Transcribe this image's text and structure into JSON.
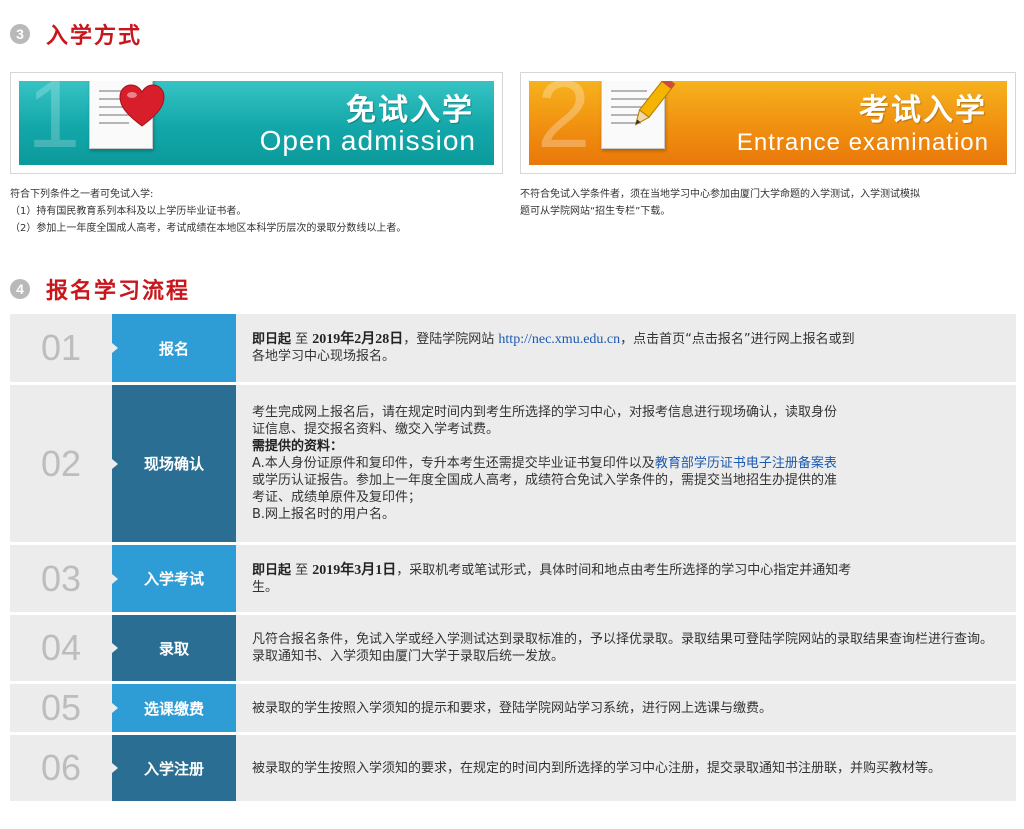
{
  "section3": {
    "number": "3",
    "title": "入学方式"
  },
  "admission": {
    "open": {
      "big_number": "1",
      "title_cn": "免试入学",
      "title_en": "Open admission",
      "lines": [
        "符合下列条件之一者可免试入学:",
        "（1）持有国民教育系列本科及以上学历毕业证书者。",
        "（2）参加上一年度全国成人高考，考试成绩在本地区本科学历层次的录取分数线以上者。"
      ]
    },
    "exam": {
      "big_number": "2",
      "title_cn": "考试入学",
      "title_en": "Entrance examination",
      "lines": [
        "不符合免试入学条件者，须在当地学习中心参加由厦门大学命题的入学测试，入学测试模拟",
        "题可从学院网站“招生专栏”下载。"
      ]
    }
  },
  "section4": {
    "number": "4",
    "title": "报名学习流程"
  },
  "steps": [
    {
      "num": "01",
      "label": "报名",
      "style": "light",
      "parts": {
        "a": "即日起",
        "b": " 至 ",
        "c": "2019年2月28日",
        "d": "，登陆学院网站 ",
        "link": "http://nec.xmu.edu.cn",
        "e": "，点击首页“点击报名”进行网上报名或到",
        "f": "各地学习中心现场报名。"
      }
    },
    {
      "num": "02",
      "label": "现场确认",
      "style": "dark",
      "lines": {
        "l1": "考生完成网上报名后，请在规定时间内到考生所选择的学习中心，对报考信息进行现场确认，读取身份",
        "l2": "证信息、提交报名资料、缴交入学考试费。",
        "l3": "需提供的资料：",
        "l4a": "A.本人身份证原件和复印件，专升本考生还需提交毕业证书复印件以及",
        "l4link": "教育部学历证书电子注册备案表",
        "l5": "或学历认证报告。参加上一年度全国成人高考，成绩符合免试入学条件的，需提交当地招生办提供的准",
        "l6": "考证、成绩单原件及复印件；",
        "l7": "B.网上报名时的用户名。"
      }
    },
    {
      "num": "03",
      "label": "入学考试",
      "style": "light",
      "parts": {
        "a": "即日起",
        "b": " 至 ",
        "c": "2019年3月1日",
        "d": "，采取机考或笔试形式，具体时间和地点由考生所选择的学习中心指定并通知考",
        "e": "生。"
      }
    },
    {
      "num": "04",
      "label": "录取",
      "style": "dark",
      "text": "凡符合报名条件，免试入学或经入学测试达到录取标准的，予以择优录取。录取结果可登陆学院网站的录取结果查询栏进行查询。录取通知书、入学须知由厦门大学于录取后统一发放。"
    },
    {
      "num": "05",
      "label": "选课缴费",
      "style": "light",
      "text": "被录取的学生按照入学须知的提示和要求，登陆学院网站学习系统，进行网上选课与缴费。"
    },
    {
      "num": "06",
      "label": "入学注册",
      "style": "dark",
      "text": "被录取的学生按照入学须知的要求，在规定的时间内到所选择的学习中心注册，提交录取通知书注册联，并购买教材等。"
    }
  ]
}
